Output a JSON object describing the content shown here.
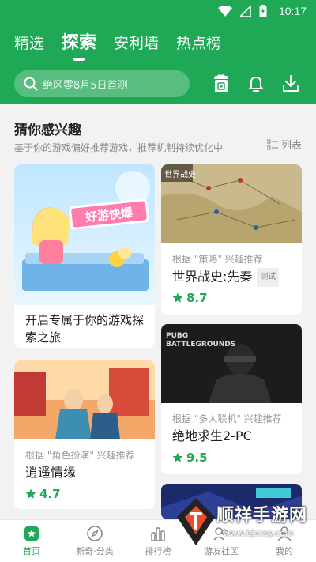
{
  "status": {
    "time": "10:17"
  },
  "tabs": [
    {
      "label": "精选"
    },
    {
      "label": "探索"
    },
    {
      "label": "安利墙"
    },
    {
      "label": "热点榜"
    }
  ],
  "search": {
    "placeholder": "绝区零8月5日首测"
  },
  "section": {
    "title": "猜你感兴趣",
    "subtitle": "基于你的游戏偏好推荐游戏，推荐机制持续优化中",
    "toggle_label": "列表"
  },
  "cards": [
    {
      "title": "开启专属于你的游戏探索之旅",
      "img_text": "好游快爆"
    },
    {
      "reason": "根据 \"策略\" 兴趣推荐",
      "title": "世界战史:先秦",
      "badge": "测试",
      "score": "8.7",
      "img_text": "世界战史"
    },
    {
      "reason": "根据 \"角色扮演\" 兴趣推荐",
      "title": "逍遥情缘",
      "score": "4.7"
    },
    {
      "reason": "根据 \"多人联机\" 兴趣推荐",
      "title": "绝地求生2-PC",
      "score": "9.5",
      "img_text": "PUBG BATTLEGROUNDS"
    }
  ],
  "bottom_nav": [
    {
      "label": "首页",
      "icon": "home-icon"
    },
    {
      "label": "新奇·分类",
      "icon": "compass-icon"
    },
    {
      "label": "排行榜",
      "icon": "chart-icon"
    },
    {
      "label": "游友社区",
      "icon": "community-icon"
    },
    {
      "label": "我的",
      "icon": "user-icon"
    }
  ],
  "watermark": {
    "text": "顺祥手游网",
    "url": "www.bjsxsy.com"
  },
  "colors": {
    "brand": "#1fa856",
    "score": "#1fa856"
  }
}
